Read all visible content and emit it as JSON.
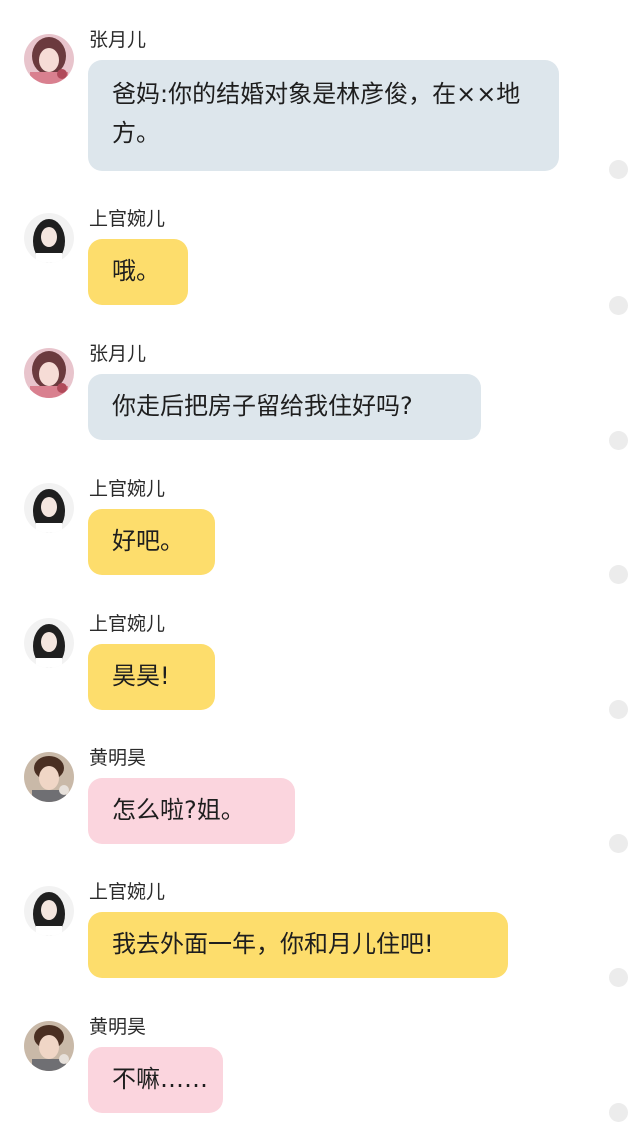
{
  "colors": {
    "bubble_zhang": "#dde6ec",
    "bubble_shangguan": "#fddd6c",
    "bubble_huang": "#fbd5de",
    "select_dot": "#ececec"
  },
  "icons": {
    "avatar_zhang": "girl-avatar-pink",
    "avatar_shangguan": "girl-avatar-dark-hair",
    "avatar_huang": "boy-avatar"
  },
  "messages": [
    {
      "sender": "张月儿",
      "text": "爸妈:你的结婚对象是林彦俊，在××地方。"
    },
    {
      "sender": "上官婉儿",
      "text": "哦。"
    },
    {
      "sender": "张月儿",
      "text": "你走后把房子留给我住好吗?"
    },
    {
      "sender": "上官婉儿",
      "text": "好吧。"
    },
    {
      "sender": "上官婉儿",
      "text": "昊昊!"
    },
    {
      "sender": "黄明昊",
      "text": "怎么啦?姐。"
    },
    {
      "sender": "上官婉儿",
      "text": "我去外面一年，你和月儿住吧!"
    },
    {
      "sender": "黄明昊",
      "text": "不嘛……"
    }
  ]
}
